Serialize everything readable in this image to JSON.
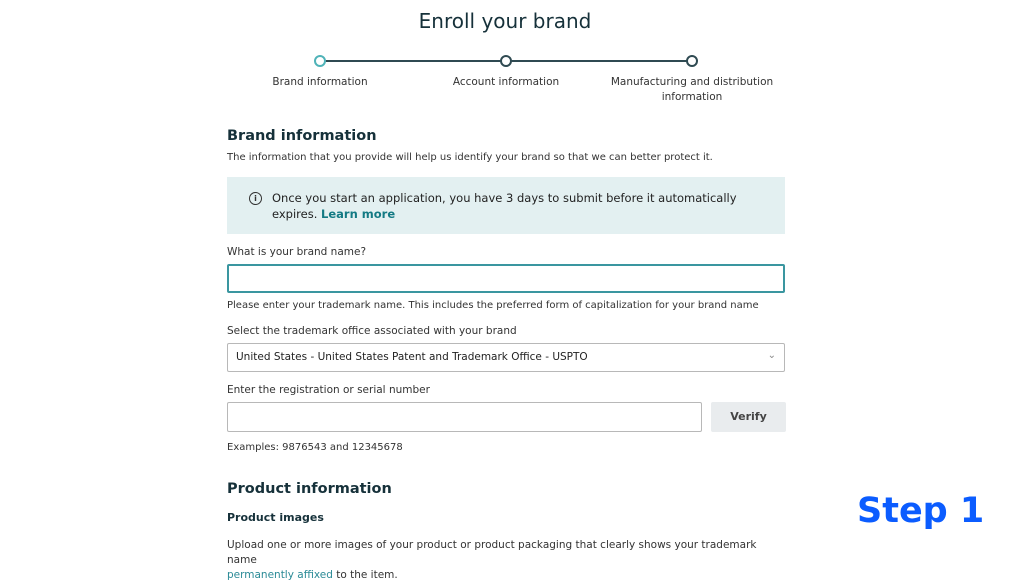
{
  "header": {
    "title": "Enroll your brand"
  },
  "stepper": {
    "steps": [
      {
        "label": "Brand information",
        "active": true
      },
      {
        "label": "Account information",
        "active": false
      },
      {
        "label_line1": "Manufacturing and distribution",
        "label_line2": "information",
        "active": false
      }
    ]
  },
  "brand_section": {
    "title": "Brand information",
    "description": "The information that you provide will help us identify your brand so that we can better protect it.",
    "alert": {
      "icon": "info-icon",
      "text": "Once you start an application, you have 3 days to submit before it automatically expires.",
      "link": "Learn more"
    },
    "brand_name": {
      "label": "What is your brand name?",
      "value": "",
      "hint": "Please enter your trademark name. This includes the preferred form of capitalization for your brand name"
    },
    "trademark_office": {
      "label": "Select the trademark office associated with your brand",
      "selected": "United States - United States Patent and Trademark Office - USPTO"
    },
    "registration": {
      "label": "Enter the registration or serial number",
      "value": "",
      "verify_label": "Verify",
      "examples": "Examples: 9876543 and 12345678"
    }
  },
  "product_section": {
    "title": "Product information",
    "subtitle": "Product images",
    "text": "Upload one or more images of your product or product packaging that clearly shows your trademark name",
    "link": "permanently affixed",
    "text_after": " to the item."
  },
  "overlay": {
    "step_badge": "Step 1",
    "color": "#0b5cff"
  }
}
